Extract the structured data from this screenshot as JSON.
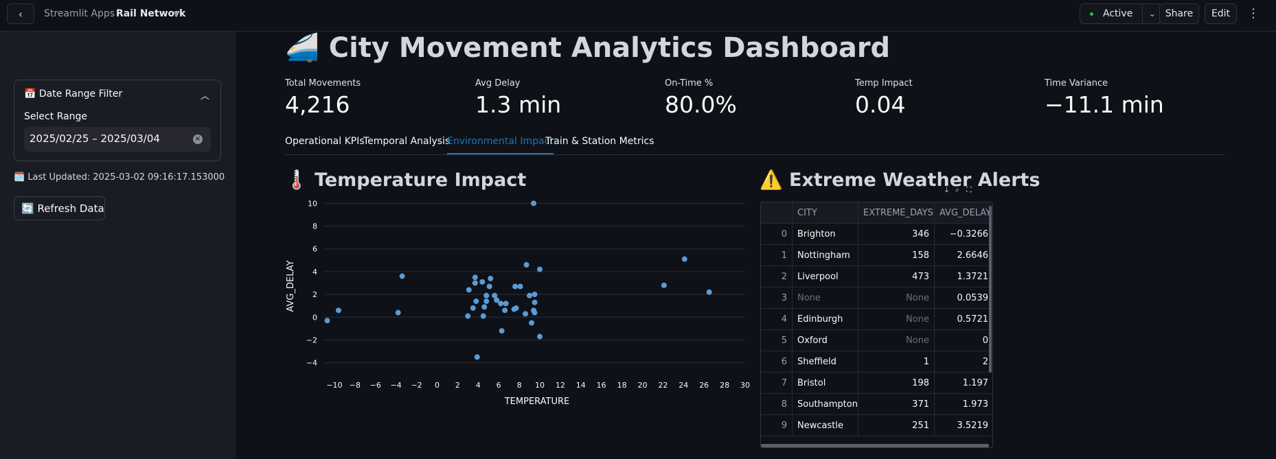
{
  "topbar": {
    "back_icon": "chevron-left-icon",
    "apps_label": "Streamlit Apps",
    "app_name": "Rail Network",
    "status": "Active",
    "share": "Share",
    "edit": "Edit",
    "menu_icon": "more-vertical-icon"
  },
  "sidebar": {
    "filter_title": "📅 Date Range Filter",
    "select_label": "Select Range",
    "date_value": "2025/02/25 – 2025/03/04",
    "last_updated": "🗓️ Last Updated: 2025-03-02 09:16:17.153000",
    "refresh": "🔄 Refresh Data"
  },
  "main": {
    "title": "🚄 City Movement Analytics Dashboard",
    "metrics": [
      {
        "label": "Total Movements",
        "value": "4,216"
      },
      {
        "label": "Avg Delay",
        "value": "1.3 min"
      },
      {
        "label": "On-Time %",
        "value": "80.0%"
      },
      {
        "label": "Temp Impact",
        "value": "0.04"
      },
      {
        "label": "Time Variance",
        "value": "-11.1 min"
      }
    ],
    "tabs": [
      "Operational KPIs",
      "Temporal Analysis",
      "Environmental Impact",
      "Train & Station Metrics"
    ],
    "active_tab": 2,
    "temp_title": "🌡️ Temperature Impact",
    "alerts_title": "⚠️ Extreme Weather Alerts"
  },
  "chart_data": {
    "type": "scatter",
    "xlabel": "TEMPERATURE",
    "ylabel": "AVG_DELAY",
    "xlim": [
      -11,
      30
    ],
    "ylim": [
      -4.5,
      10.2
    ],
    "x_ticks": [
      -10,
      -8,
      -6,
      -4,
      -2,
      0,
      2,
      4,
      6,
      8,
      10,
      12,
      14,
      16,
      18,
      20,
      22,
      24,
      26,
      28,
      30
    ],
    "y_ticks": [
      -4,
      -2,
      0,
      2,
      4,
      6,
      8,
      10
    ],
    "color": "#5b9bd5",
    "points": [
      [
        -10.7,
        -0.3
      ],
      [
        -9.6,
        0.6
      ],
      [
        -3.8,
        0.4
      ],
      [
        -3.4,
        3.6
      ],
      [
        3.0,
        0.1
      ],
      [
        3.1,
        2.4
      ],
      [
        3.5,
        0.8
      ],
      [
        3.7,
        3.0
      ],
      [
        3.7,
        3.5
      ],
      [
        3.8,
        1.4
      ],
      [
        3.9,
        -3.5
      ],
      [
        4.4,
        3.1
      ],
      [
        4.5,
        0.1
      ],
      [
        4.6,
        0.9
      ],
      [
        4.8,
        1.4
      ],
      [
        4.8,
        1.9
      ],
      [
        5.1,
        2.7
      ],
      [
        5.2,
        3.4
      ],
      [
        5.6,
        1.9
      ],
      [
        5.8,
        1.5
      ],
      [
        6.2,
        1.2
      ],
      [
        6.3,
        -1.2
      ],
      [
        6.6,
        0.6
      ],
      [
        6.7,
        1.2
      ],
      [
        7.5,
        0.7
      ],
      [
        7.6,
        2.7
      ],
      [
        7.7,
        0.8
      ],
      [
        8.1,
        2.7
      ],
      [
        8.6,
        0.3
      ],
      [
        8.7,
        4.6
      ],
      [
        9.0,
        1.9
      ],
      [
        9.2,
        -0.5
      ],
      [
        9.4,
        0.6
      ],
      [
        9.5,
        0.4
      ],
      [
        9.5,
        1.3
      ],
      [
        9.5,
        2.0
      ],
      [
        9.4,
        10.0
      ],
      [
        10.0,
        4.2
      ],
      [
        10.0,
        -1.7
      ],
      [
        22.1,
        2.8
      ],
      [
        24.1,
        5.1
      ],
      [
        26.5,
        2.2
      ]
    ]
  },
  "table": {
    "toolbar_icons": [
      "download-icon",
      "search-icon",
      "fullscreen-icon"
    ],
    "columns": [
      "",
      "CITY",
      "EXTREME_DAYS",
      "AVG_DELAY"
    ],
    "rows": [
      [
        "0",
        "Brighton",
        "346",
        "-0.3266"
      ],
      [
        "1",
        "Nottingham",
        "158",
        "2.6646"
      ],
      [
        "2",
        "Liverpool",
        "473",
        "1.3721"
      ],
      [
        "3",
        "None",
        "None",
        "0.0539"
      ],
      [
        "4",
        "Edinburgh",
        "None",
        "0.5721"
      ],
      [
        "5",
        "Oxford",
        "None",
        "0"
      ],
      [
        "6",
        "Sheffield",
        "1",
        "2"
      ],
      [
        "7",
        "Bristol",
        "198",
        "1.197"
      ],
      [
        "8",
        "Southampton",
        "371",
        "1.973"
      ],
      [
        "9",
        "Newcastle",
        "251",
        "3.5219"
      ]
    ]
  }
}
